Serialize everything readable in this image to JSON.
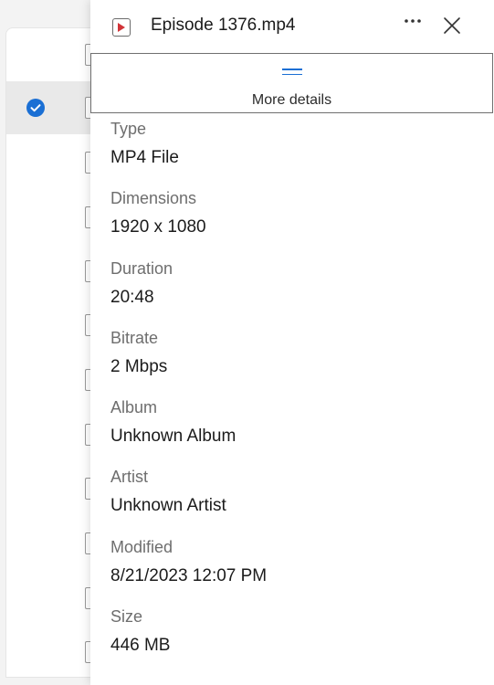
{
  "details_pane": {
    "file_name": "Episode 1376.mp4",
    "more_details_label": "More details",
    "properties": [
      {
        "label": "Type",
        "value": "MP4 File"
      },
      {
        "label": "Dimensions",
        "value": "1920 x 1080"
      },
      {
        "label": "Duration",
        "value": "20:48"
      },
      {
        "label": "Bitrate",
        "value": "2 Mbps"
      },
      {
        "label": "Album",
        "value": "Unknown Album"
      },
      {
        "label": "Artist",
        "value": "Unknown Artist"
      },
      {
        "label": "Modified",
        "value": "8/21/2023 12:07 PM"
      },
      {
        "label": "Size",
        "value": "446 MB"
      }
    ]
  },
  "icons": {
    "file": "video-file-icon",
    "more": "more-options-icon",
    "close": "close-icon",
    "check": "checkmark-icon"
  },
  "colors": {
    "accent": "#1a6fd4",
    "label_gray": "#6e6e6e",
    "selected_row": "#e9e9e9",
    "video_icon_red": "#d13438"
  }
}
